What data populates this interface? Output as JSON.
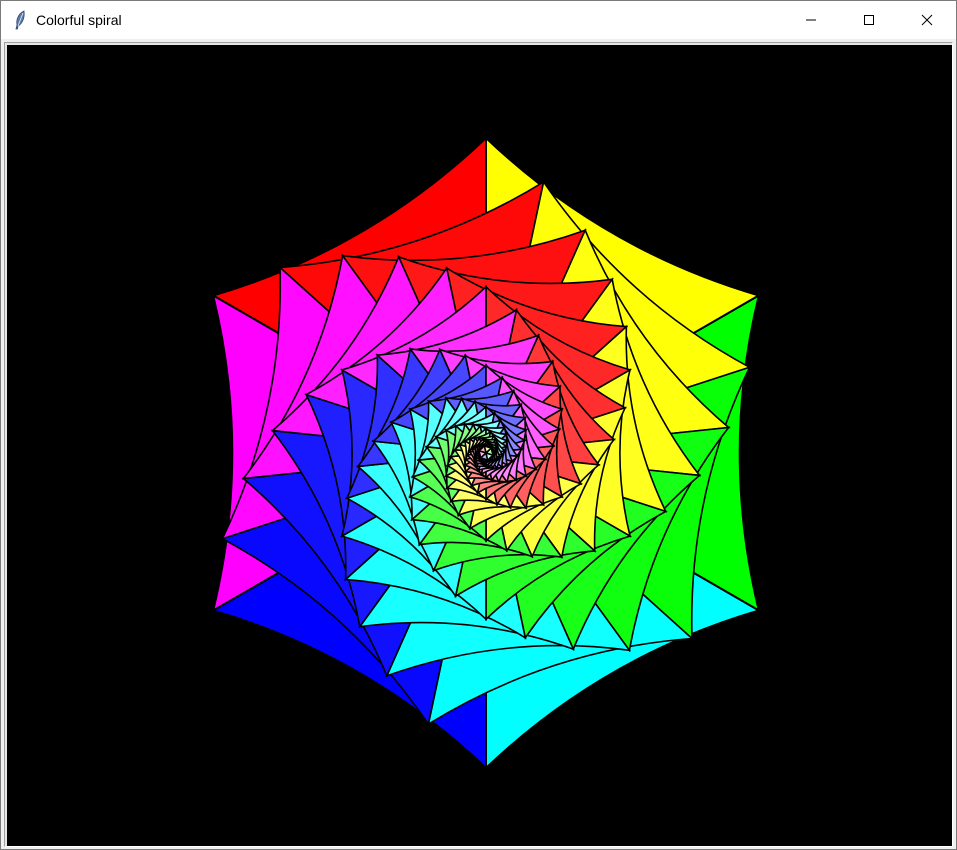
{
  "window": {
    "title": "Colorful spiral",
    "app_icon": "feather-icon",
    "controls": [
      "minimize-icon",
      "maximize-icon",
      "close-icon"
    ]
  },
  "canvas": {
    "background": "#000000",
    "outline_color": "#000000",
    "colors": [
      "#ff0000",
      "#ffff00",
      "#00ff00",
      "#00ffff",
      "#0000ff",
      "#ff00ff"
    ]
  }
}
